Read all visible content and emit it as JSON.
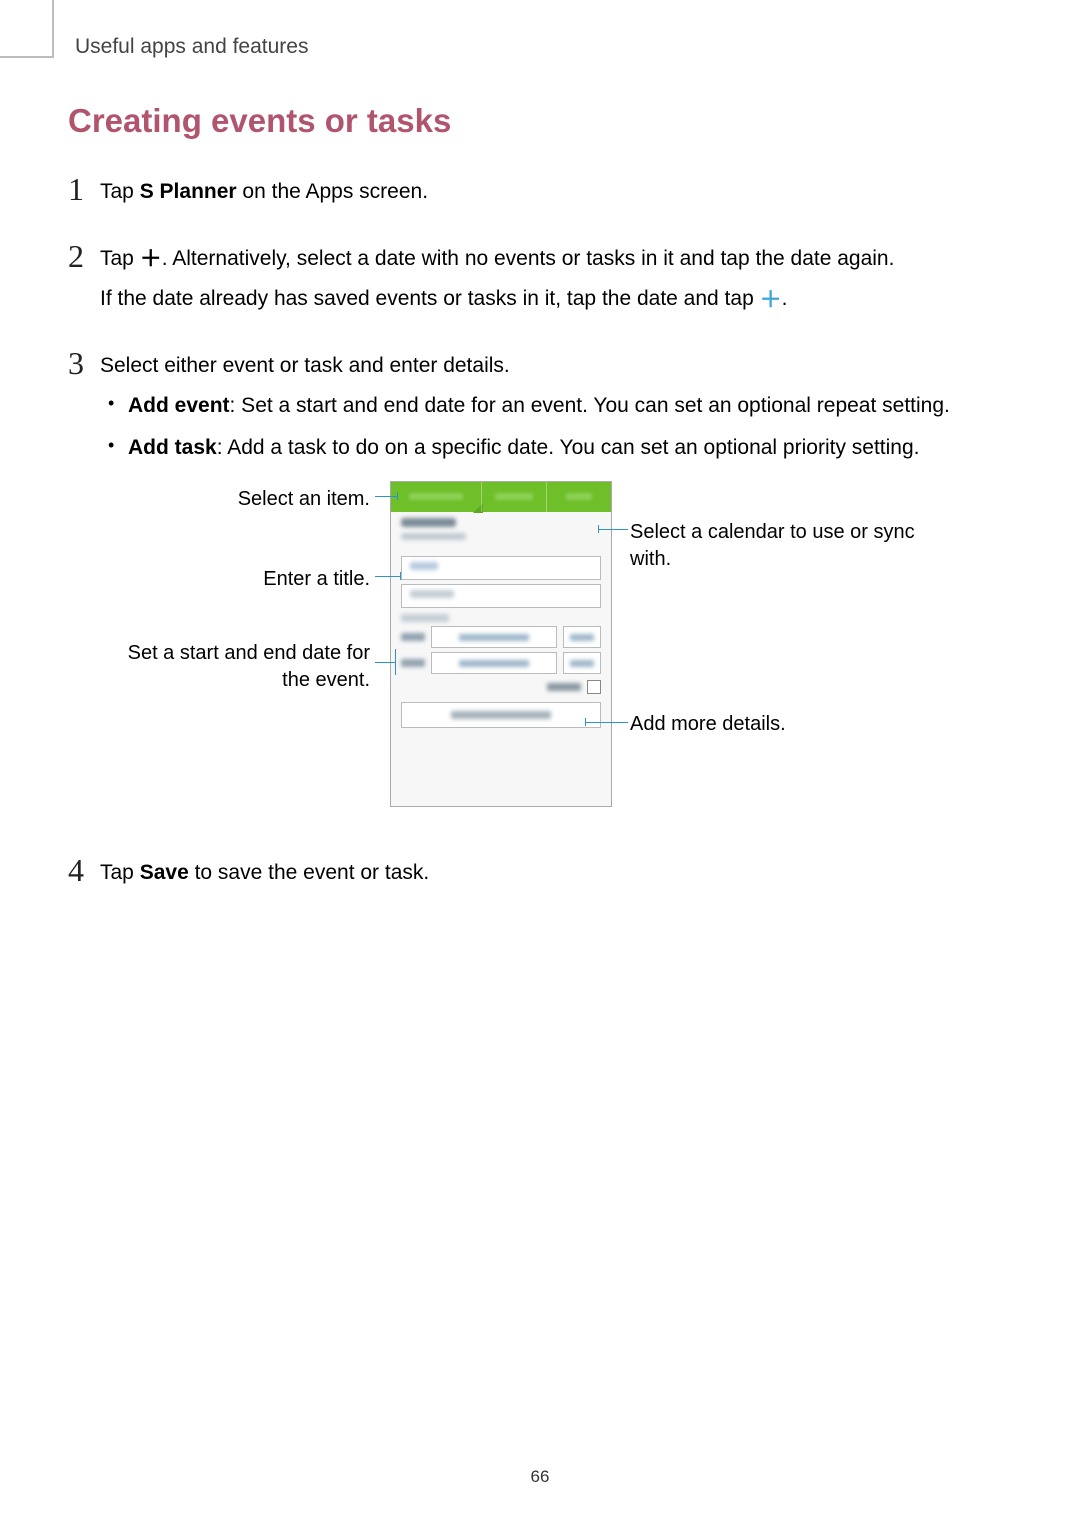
{
  "header": {
    "section": "Useful apps and features"
  },
  "title": "Creating events or tasks",
  "steps": {
    "s1": {
      "num": "1",
      "pre": "Tap ",
      "bold": "S Planner",
      "post": " on the Apps screen."
    },
    "s2": {
      "num": "2",
      "line1_pre": "Tap ",
      "line1_post": ". Alternatively, select a date with no events or tasks in it and tap the date again.",
      "line2_pre": "If the date already has saved events or tasks in it, tap the date and tap ",
      "line2_post": "."
    },
    "s3": {
      "num": "3",
      "intro": "Select either event or task and enter details.",
      "b1_bold": "Add event",
      "b1_rest": ": Set a start and end date for an event. You can set an optional repeat setting.",
      "b2_bold": "Add task",
      "b2_rest": ": Add a task to do on a specific date. You can set an optional priority setting."
    },
    "s4": {
      "num": "4",
      "pre": "Tap ",
      "bold": "Save",
      "post": " to save the event or task."
    }
  },
  "callouts": {
    "select_item": "Select an item.",
    "enter_title": "Enter a title.",
    "set_dates": "Set a start and end date for the event.",
    "select_calendar": "Select a calendar to use or sync with.",
    "add_more": "Add more details."
  },
  "page": "66"
}
